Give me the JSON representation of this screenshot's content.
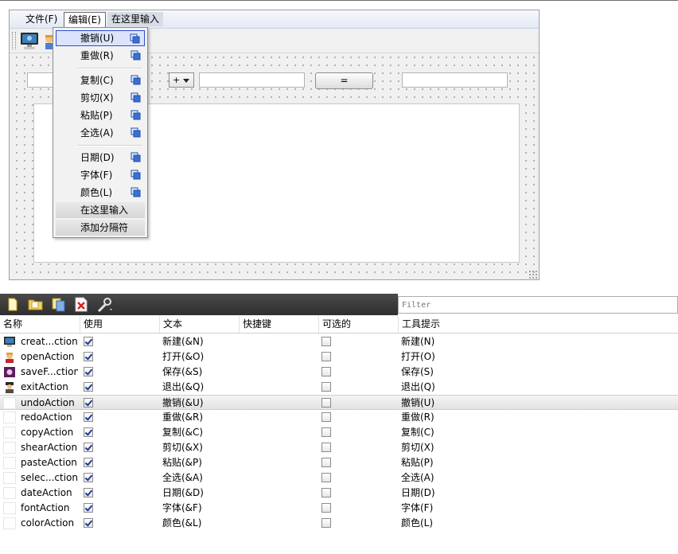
{
  "form": {
    "menubar": [
      "文件(F)",
      "编辑(E)",
      "在这里输入"
    ],
    "operator": "+",
    "equals_label": "="
  },
  "edit_menu": {
    "items": [
      {
        "label": "撤销(U)"
      },
      {
        "label": "重做(R)"
      },
      {
        "label": "复制(C)"
      },
      {
        "label": "剪切(X)"
      },
      {
        "label": "粘贴(P)"
      },
      {
        "label": "全选(A)"
      },
      {
        "label": "日期(D)"
      },
      {
        "label": "字体(F)"
      },
      {
        "label": "颜色(L)"
      }
    ],
    "type_here": "在这里输入",
    "add_separator": "添加分隔符"
  },
  "action_editor": {
    "filter_placeholder": "Filter",
    "headers": [
      "名称",
      "使用",
      "文本",
      "快捷键",
      "可选的",
      "工具提示"
    ],
    "rows": [
      {
        "name": "creat...ction",
        "text": "新建(&N)",
        "tip": "新建(N)",
        "icon": "monitor-icon"
      },
      {
        "name": "openAction",
        "text": "打开(&O)",
        "tip": "打开(O)",
        "icon": "person-icon"
      },
      {
        "name": "saveF...ction",
        "text": "保存(&S)",
        "tip": "保存(S)",
        "icon": "save-image-icon"
      },
      {
        "name": "exitAction",
        "text": "退出(&Q)",
        "tip": "退出(Q)",
        "icon": "exit-person-icon"
      },
      {
        "name": "undoAction",
        "text": "撤销(&U)",
        "tip": "撤销(U)",
        "icon": ""
      },
      {
        "name": "redoAction",
        "text": "重做(&R)",
        "tip": "重做(R)",
        "icon": ""
      },
      {
        "name": "copyAction",
        "text": "复制(&C)",
        "tip": "复制(C)",
        "icon": ""
      },
      {
        "name": "shearAction",
        "text": "剪切(&X)",
        "tip": "剪切(X)",
        "icon": ""
      },
      {
        "name": "pasteAction",
        "text": "粘贴(&P)",
        "tip": "粘贴(P)",
        "icon": ""
      },
      {
        "name": "selec...ction",
        "text": "全选(&A)",
        "tip": "全选(A)",
        "icon": ""
      },
      {
        "name": "dateAction",
        "text": "日期(&D)",
        "tip": "日期(D)",
        "icon": ""
      },
      {
        "name": "fontAction",
        "text": "字体(&F)",
        "tip": "字体(F)",
        "icon": ""
      },
      {
        "name": "colorAction",
        "text": "颜色(&L)",
        "tip": "颜色(L)",
        "icon": ""
      }
    ],
    "selected_row": 4
  }
}
